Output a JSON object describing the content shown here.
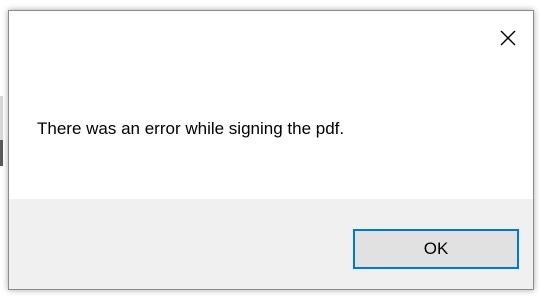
{
  "dialog": {
    "message": "There was an error while signing the pdf.",
    "close_icon": "close-icon",
    "ok_label": "OK"
  },
  "colors": {
    "footer_background": "#f0f0f0",
    "button_background": "#e1e1e1",
    "button_focus_border": "#0078d7"
  }
}
